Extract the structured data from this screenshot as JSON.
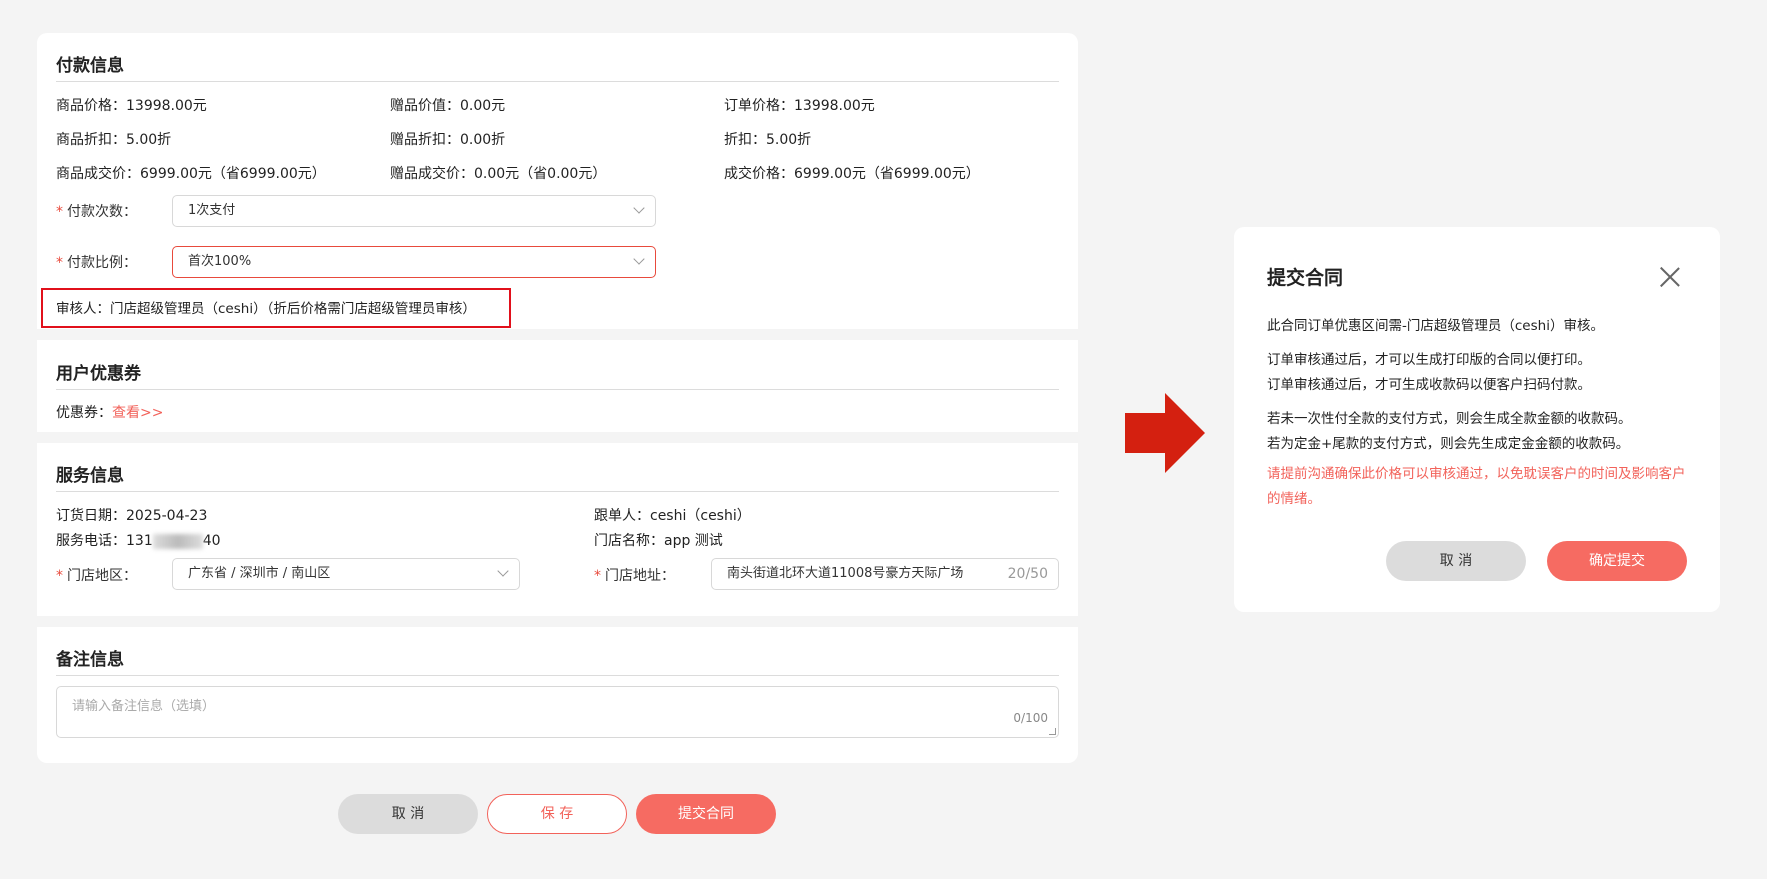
{
  "payment": {
    "title": "付款信息",
    "rows": [
      [
        "商品价格：13998.00元",
        "赠品价值：0.00元",
        "订单价格：13998.00元"
      ],
      [
        "商品折扣：5.00折",
        "赠品折扣：0.00折",
        "折扣：5.00折"
      ],
      [
        "商品成交价：6999.00元（省6999.00元）",
        "赠品成交价：0.00元（省0.00元）",
        "成交价格：6999.00元（省6999.00元）"
      ]
    ],
    "pay_times_label": "付款次数：",
    "pay_times_value": "1次支付",
    "pay_ratio_label": "付款比例：",
    "pay_ratio_value": "首次100%",
    "reviewer": "审核人：门店超级管理员（ceshi）（折后价格需门店超级管理员审核）"
  },
  "coupon": {
    "title": "用户优惠券",
    "label": "优惠券：",
    "link": "查看>>"
  },
  "service": {
    "title": "服务信息",
    "order_date": "订货日期：2025-04-23",
    "follower": "跟单人：ceshi（ceshi）",
    "phone_prefix": "服务电话：131",
    "phone_suffix": "40",
    "store_name": "门店名称：app 测试",
    "region_label": "门店地区：",
    "region_value": "广东省 / 深圳市 / 南山区",
    "address_label": "门店地址：",
    "address_value": "南头街道北环大道11008号豪方天际广场",
    "address_count": "20/50"
  },
  "remark": {
    "title": "备注信息",
    "placeholder": "请输入备注信息（选填）",
    "count": "0/100"
  },
  "actions": {
    "cancel": "取 消",
    "save": "保 存",
    "submit": "提交合同"
  },
  "modal": {
    "title": "提交合同",
    "line1": "此合同订单优惠区间需-门店超级管理员（ceshi）审核。",
    "line2": "订单审核通过后，才可以生成打印版的合同以便打印。",
    "line3": "订单审核通过后，才可生成收款码以便客户扫码付款。",
    "line4": "若未一次性付全款的支付方式，则会生成全款金额的收款码。",
    "line5": "若为定金+尾款的支付方式，则会先生成定金金额的收款码。",
    "warning": "请提前沟通确保此价格可以审核通过，以免耽误客户的时间及影响客户的情绪。",
    "cancel": "取 消",
    "confirm": "确定提交"
  },
  "colors": {
    "accent": "#f66b62",
    "highlight_box": "#e1101b",
    "arrow": "#d42010"
  }
}
